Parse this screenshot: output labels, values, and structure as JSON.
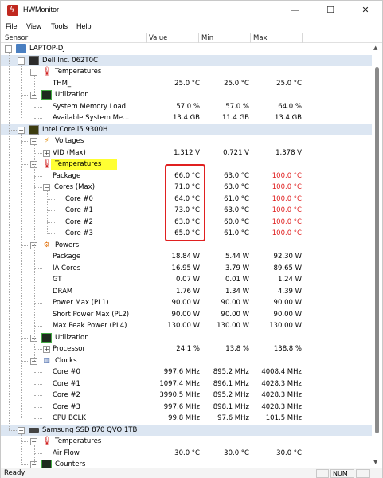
{
  "window": {
    "title": "HWMonitor"
  },
  "menu": [
    "File",
    "View",
    "Tools",
    "Help"
  ],
  "columns": {
    "sensor": "Sensor",
    "value": "Value",
    "min": "Min",
    "max": "Max"
  },
  "rows": [
    {
      "label": "LAPTOP-DJ",
      "kind": "root",
      "icon": "computer-icon"
    },
    {
      "label": "Dell Inc. 062T0C",
      "kind": "device",
      "icon": "motherboard-icon"
    },
    {
      "label": "Temperatures",
      "kind": "group",
      "icon": "thermometer-icon"
    },
    {
      "label": "THM_",
      "value": "25.0 °C",
      "min": "25.0 °C",
      "max": "25.0 °C"
    },
    {
      "label": "Utilization",
      "kind": "group",
      "icon": "graph-icon"
    },
    {
      "label": "System Memory Load",
      "value": "57.0 %",
      "min": "57.0 %",
      "max": "64.0 %"
    },
    {
      "label": "Available System Me...",
      "value": "13.4 GB",
      "min": "11.4 GB",
      "max": "13.4 GB"
    },
    {
      "label": "Intel Core i5 9300H",
      "kind": "device",
      "icon": "cpu-icon"
    },
    {
      "label": "Voltages",
      "kind": "group",
      "icon": "voltage-icon"
    },
    {
      "label": "VID (Max)",
      "value": "1.312 V",
      "min": "0.721 V",
      "max": "1.378 V"
    },
    {
      "label": "Temperatures",
      "kind": "group",
      "icon": "thermometer-icon",
      "highlight": true
    },
    {
      "label": "Package",
      "value": "66.0 °C",
      "min": "63.0 °C",
      "max": "100.0 °C",
      "maxRed": true
    },
    {
      "label": "Cores (Max)",
      "value": "71.0 °C",
      "min": "63.0 °C",
      "max": "100.0 °C",
      "maxRed": true
    },
    {
      "label": "Core #0",
      "value": "64.0 °C",
      "min": "61.0 °C",
      "max": "100.0 °C",
      "maxRed": true
    },
    {
      "label": "Core #1",
      "value": "73.0 °C",
      "min": "63.0 °C",
      "max": "100.0 °C",
      "maxRed": true
    },
    {
      "label": "Core #2",
      "value": "63.0 °C",
      "min": "60.0 °C",
      "max": "100.0 °C",
      "maxRed": true
    },
    {
      "label": "Core #3",
      "value": "65.0 °C",
      "min": "61.0 °C",
      "max": "100.0 °C",
      "maxRed": true
    },
    {
      "label": "Powers",
      "kind": "group",
      "icon": "power-icon"
    },
    {
      "label": "Package",
      "value": "18.84 W",
      "min": "5.44 W",
      "max": "92.30 W"
    },
    {
      "label": "IA Cores",
      "value": "16.95 W",
      "min": "3.79 W",
      "max": "89.65 W"
    },
    {
      "label": "GT",
      "value": "0.07 W",
      "min": "0.01 W",
      "max": "1.24 W"
    },
    {
      "label": "DRAM",
      "value": "1.76 W",
      "min": "1.34 W",
      "max": "4.39 W"
    },
    {
      "label": "Power Max (PL1)",
      "value": "90.00 W",
      "min": "90.00 W",
      "max": "90.00 W"
    },
    {
      "label": "Short Power Max (PL2)",
      "value": "90.00 W",
      "min": "90.00 W",
      "max": "90.00 W"
    },
    {
      "label": "Max Peak Power (PL4)",
      "value": "130.00 W",
      "min": "130.00 W",
      "max": "130.00 W"
    },
    {
      "label": "Utilization",
      "kind": "group",
      "icon": "graph-icon"
    },
    {
      "label": "Processor",
      "value": "24.1 %",
      "min": "13.8 %",
      "max": "138.8 %"
    },
    {
      "label": "Clocks",
      "kind": "group",
      "icon": "clock-icon"
    },
    {
      "label": "Core #0",
      "value": "997.6 MHz",
      "min": "895.2 MHz",
      "max": "4008.4 MHz"
    },
    {
      "label": "Core #1",
      "value": "1097.4 MHz",
      "min": "896.1 MHz",
      "max": "4028.3 MHz"
    },
    {
      "label": "Core #2",
      "value": "3990.5 MHz",
      "min": "895.2 MHz",
      "max": "4028.3 MHz"
    },
    {
      "label": "Core #3",
      "value": "997.6 MHz",
      "min": "898.1 MHz",
      "max": "4028.3 MHz"
    },
    {
      "label": "CPU BCLK",
      "value": "99.8 MHz",
      "min": "97.6 MHz",
      "max": "101.5 MHz"
    },
    {
      "label": "Samsung SSD 870 QVO 1TB",
      "kind": "device",
      "icon": "ssd-icon"
    },
    {
      "label": "Temperatures",
      "kind": "group",
      "icon": "thermometer-icon"
    },
    {
      "label": "Air Flow",
      "value": "30.0 °C",
      "min": "30.0 °C",
      "max": "30.0 °C"
    },
    {
      "label": "Counters",
      "kind": "group",
      "icon": "counter-icon"
    }
  ],
  "status": {
    "text": "Ready",
    "num": "NUM"
  },
  "colors": {
    "device_row": "#dce6f2",
    "alert": "#e02020",
    "highlight": "#ffff33"
  }
}
